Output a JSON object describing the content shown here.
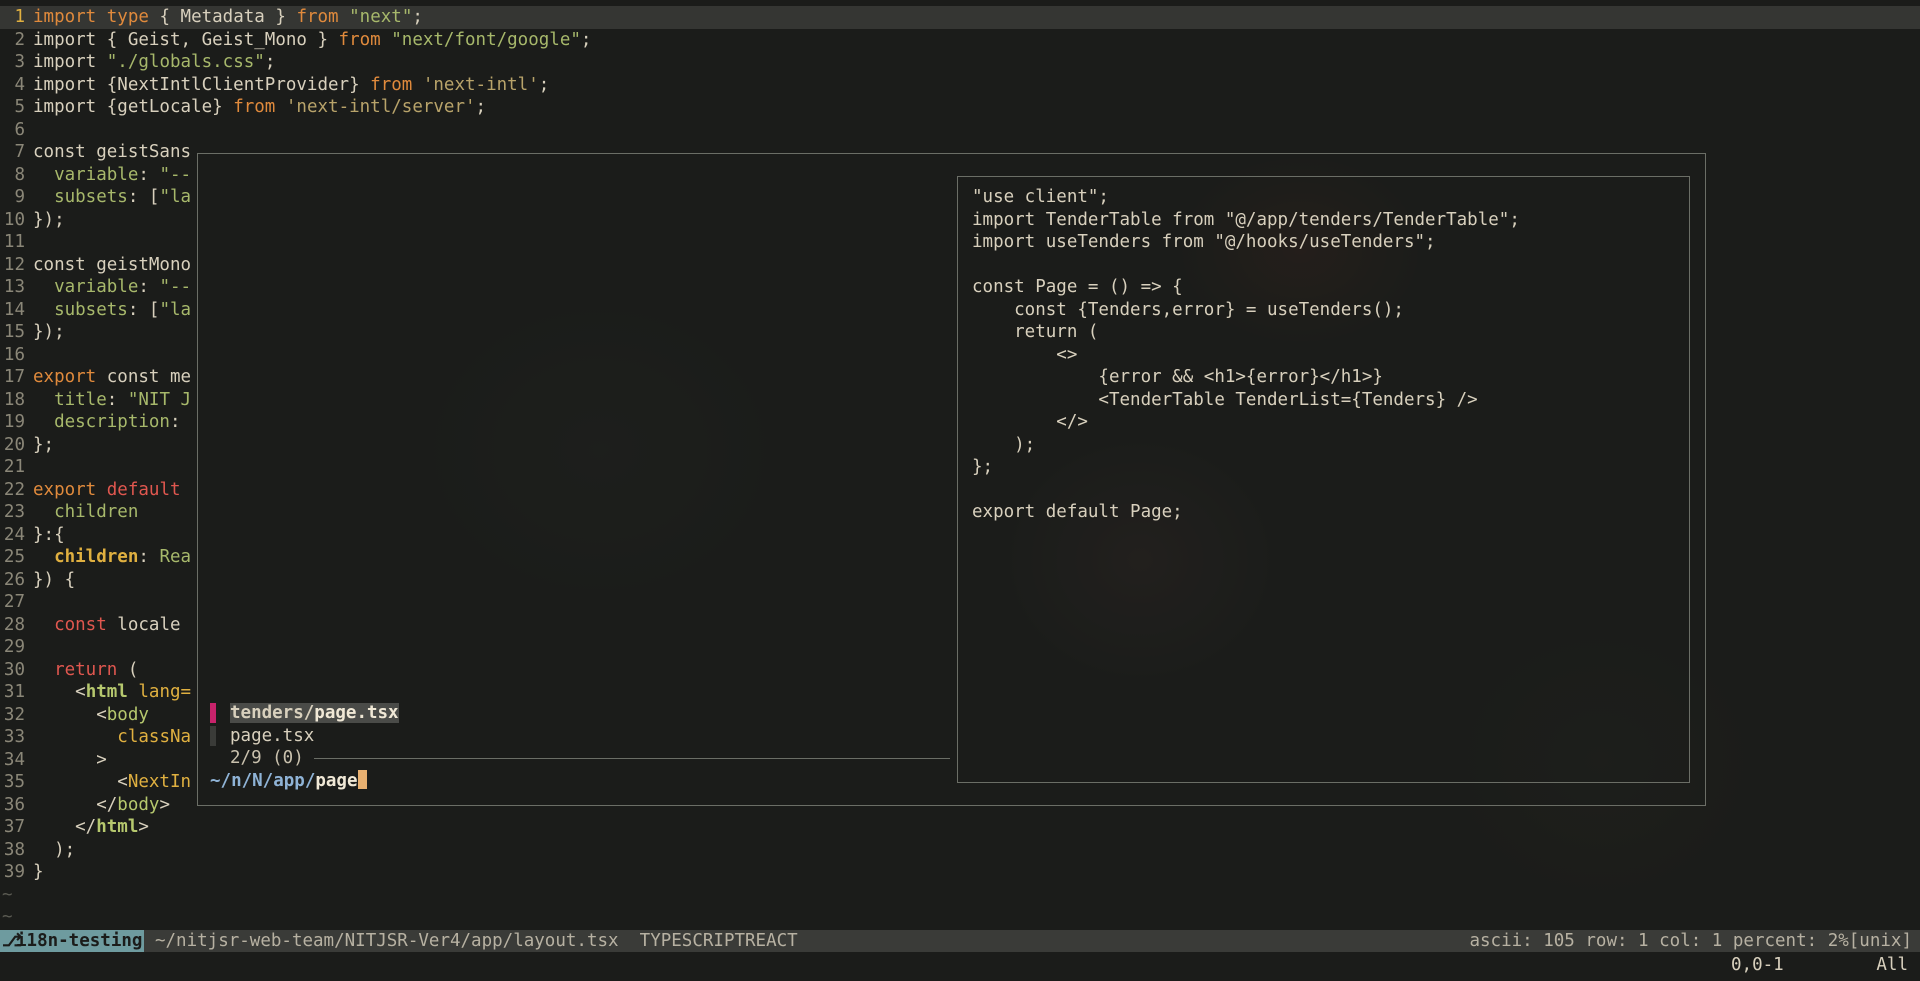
{
  "editor": {
    "lines": [
      {
        "n": "1",
        "current": true,
        "segs": [
          [
            "kw",
            "import"
          ],
          [
            "plain",
            " "
          ],
          [
            "kw",
            "type"
          ],
          [
            "plain",
            " { Metadata } "
          ],
          [
            "kw",
            "from"
          ],
          [
            "plain",
            " "
          ],
          [
            "str",
            "\"next\""
          ],
          [
            "plain",
            ";"
          ]
        ]
      },
      {
        "n": "2",
        "segs": [
          [
            "plain",
            "import { Geist, Geist_Mono } "
          ],
          [
            "kw",
            "from"
          ],
          [
            "plain",
            " "
          ],
          [
            "str",
            "\"next/font/google\""
          ],
          [
            "plain",
            ";"
          ]
        ]
      },
      {
        "n": "3",
        "segs": [
          [
            "plain",
            "import "
          ],
          [
            "str",
            "\"./globals.css\""
          ],
          [
            "plain",
            ";"
          ]
        ]
      },
      {
        "n": "4",
        "segs": [
          [
            "plain",
            "import {NextIntlClientProvider} "
          ],
          [
            "kw",
            "from"
          ],
          [
            "plain",
            " "
          ],
          [
            "str2",
            "'next-intl'"
          ],
          [
            "plain",
            ";"
          ]
        ]
      },
      {
        "n": "5",
        "segs": [
          [
            "plain",
            "import {getLocale} "
          ],
          [
            "kw",
            "from"
          ],
          [
            "plain",
            " "
          ],
          [
            "str2",
            "'next-intl/server'"
          ],
          [
            "plain",
            ";"
          ]
        ]
      },
      {
        "n": "6",
        "segs": []
      },
      {
        "n": "7",
        "segs": [
          [
            "plain",
            "const geistSans"
          ]
        ]
      },
      {
        "n": "8",
        "segs": [
          [
            "plain",
            "  "
          ],
          [
            "prop",
            "variable"
          ],
          [
            "plain",
            ": "
          ],
          [
            "str",
            "\"--"
          ]
        ]
      },
      {
        "n": "9",
        "segs": [
          [
            "plain",
            "  "
          ],
          [
            "prop",
            "subsets"
          ],
          [
            "plain",
            ": ["
          ],
          [
            "str",
            "\"la"
          ]
        ]
      },
      {
        "n": "10",
        "segs": [
          [
            "plain",
            "});"
          ]
        ]
      },
      {
        "n": "11",
        "segs": []
      },
      {
        "n": "12",
        "segs": [
          [
            "plain",
            "const geistMono"
          ]
        ]
      },
      {
        "n": "13",
        "segs": [
          [
            "plain",
            "  "
          ],
          [
            "prop",
            "variable"
          ],
          [
            "plain",
            ": "
          ],
          [
            "str",
            "\"--"
          ]
        ]
      },
      {
        "n": "14",
        "segs": [
          [
            "plain",
            "  "
          ],
          [
            "prop",
            "subsets"
          ],
          [
            "plain",
            ": ["
          ],
          [
            "str",
            "\"la"
          ]
        ]
      },
      {
        "n": "15",
        "segs": [
          [
            "plain",
            "});"
          ]
        ]
      },
      {
        "n": "16",
        "segs": []
      },
      {
        "n": "17",
        "segs": [
          [
            "kw",
            "export"
          ],
          [
            "plain",
            " const me"
          ]
        ]
      },
      {
        "n": "18",
        "segs": [
          [
            "plain",
            "  "
          ],
          [
            "prop",
            "title"
          ],
          [
            "plain",
            ": "
          ],
          [
            "str",
            "\"NIT J"
          ]
        ]
      },
      {
        "n": "19",
        "segs": [
          [
            "plain",
            "  "
          ],
          [
            "prop",
            "description"
          ],
          [
            "plain",
            ":"
          ]
        ]
      },
      {
        "n": "20",
        "segs": [
          [
            "plain",
            "};"
          ]
        ]
      },
      {
        "n": "21",
        "segs": []
      },
      {
        "n": "22",
        "segs": [
          [
            "kw",
            "export"
          ],
          [
            "plain",
            " "
          ],
          [
            "kw2",
            "default"
          ]
        ]
      },
      {
        "n": "23",
        "segs": [
          [
            "plain",
            "  "
          ],
          [
            "prop",
            "children"
          ]
        ]
      },
      {
        "n": "24",
        "segs": [
          [
            "plain",
            "}:{"
          ]
        ]
      },
      {
        "n": "25",
        "segs": [
          [
            "plain",
            "  "
          ],
          [
            "attr bold",
            "children"
          ],
          [
            "plain",
            ": "
          ],
          [
            "prop",
            "Rea"
          ]
        ]
      },
      {
        "n": "26",
        "segs": [
          [
            "plain",
            "}) {"
          ]
        ]
      },
      {
        "n": "27",
        "segs": []
      },
      {
        "n": "28",
        "segs": [
          [
            "plain",
            "  "
          ],
          [
            "kw2",
            "const"
          ],
          [
            "plain",
            " locale"
          ]
        ]
      },
      {
        "n": "29",
        "segs": []
      },
      {
        "n": "30",
        "segs": [
          [
            "plain",
            "  "
          ],
          [
            "kw2",
            "return"
          ],
          [
            "plain",
            " ("
          ]
        ]
      },
      {
        "n": "31",
        "segs": [
          [
            "plain",
            "    <"
          ],
          [
            "tag bold",
            "html"
          ],
          [
            "plain",
            " "
          ],
          [
            "attr",
            "lang="
          ]
        ]
      },
      {
        "n": "32",
        "segs": [
          [
            "plain",
            "      <"
          ],
          [
            "tag",
            "body"
          ]
        ]
      },
      {
        "n": "33",
        "segs": [
          [
            "plain",
            "        "
          ],
          [
            "attr",
            "classNa"
          ]
        ]
      },
      {
        "n": "34",
        "segs": [
          [
            "plain",
            "      >"
          ]
        ]
      },
      {
        "n": "35",
        "segs": [
          [
            "plain",
            "        <"
          ],
          [
            "attr",
            "NextIn"
          ]
        ]
      },
      {
        "n": "36",
        "segs": [
          [
            "plain",
            "      </"
          ],
          [
            "tag",
            "body"
          ],
          [
            "plain",
            ">"
          ]
        ]
      },
      {
        "n": "37",
        "segs": [
          [
            "plain",
            "    </"
          ],
          [
            "tag bold",
            "html"
          ],
          [
            "plain",
            ">"
          ]
        ]
      },
      {
        "n": "38",
        "segs": [
          [
            "plain",
            "  );"
          ]
        ]
      },
      {
        "n": "39",
        "segs": [
          [
            "plain",
            "}"
          ]
        ]
      }
    ],
    "tildes": [
      "~",
      "~"
    ]
  },
  "finder": {
    "preview_lines": [
      "\"use client\";",
      "import TenderTable from \"@/app/tenders/TenderTable\";",
      "import useTenders from \"@/hooks/useTenders\";",
      "",
      "const Page = () => {",
      "    const {Tenders,error} = useTenders();",
      "    return (",
      "        <>",
      "            {error && <h1>{error}</h1>}",
      "            <TenderTable TenderList={Tenders} />",
      "        </>",
      "    );",
      "};",
      "",
      "export default Page;"
    ],
    "results": [
      {
        "dir": "tenders/",
        "file": "page.tsx",
        "selected": true
      },
      {
        "dir": "",
        "file": "page.tsx",
        "selected": false
      }
    ],
    "count": "2/9 (0)",
    "prompt_path": "~/n/N/app/",
    "prompt_query": "page"
  },
  "statusbar": {
    "branch": "i18n-testing",
    "path": "~/nitjsr-web-team/NITJSR-Ver4/app/layout.tsx",
    "filetype": "TYPESCRIPTREACT",
    "right": "ascii: 105 row: 1 col: 1 percent: 2%[unix]"
  },
  "cmdline": {
    "ruler": "0,0-1",
    "scroll": "All"
  },
  "colors": {
    "accent_marker": "#c8236b",
    "branch_bg": "#6e9b9f",
    "keyword": "#e08a3c",
    "string": "#a7b86b"
  }
}
